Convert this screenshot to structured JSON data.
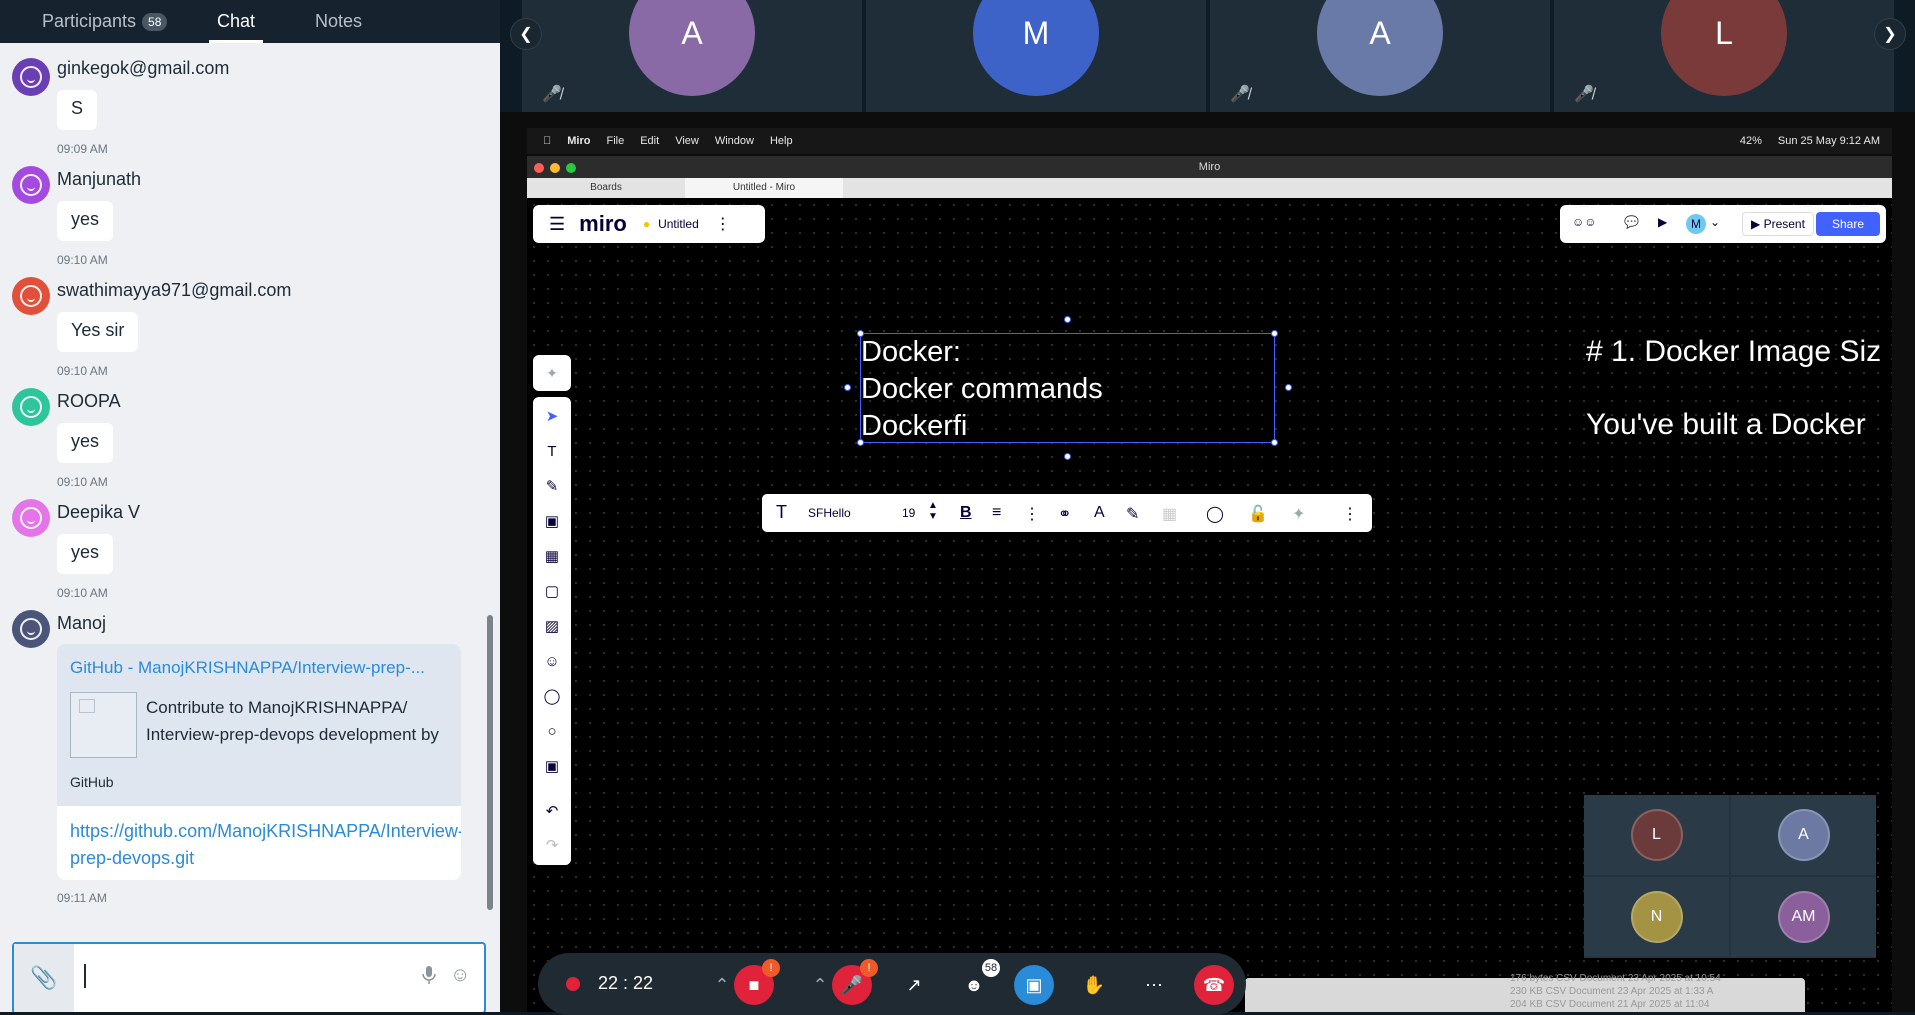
{
  "chat_panel": {
    "tabs": [
      {
        "label": "Participants",
        "count": "58"
      },
      {
        "label": "Chat"
      },
      {
        "label": "Notes"
      }
    ],
    "messages": [
      {
        "sender": "ginkegok@gmail.com",
        "text": "S",
        "time": "09:09 AM",
        "color": "#6a3fb5"
      },
      {
        "sender": "Manjunath",
        "text": "yes",
        "time": "09:10 AM",
        "color": "#a34be0"
      },
      {
        "sender": "swathimayya971@gmail.com",
        "text": "Yes sir",
        "time": "09:10 AM",
        "color": "#e0503a"
      },
      {
        "sender": "ROOPA",
        "text": "yes",
        "time": "09:10 AM",
        "color": "#2fc59c"
      },
      {
        "sender": "Deepika V",
        "text": "yes",
        "time": "09:10 AM",
        "color": "#e574e8"
      },
      {
        "sender": "Manoj",
        "time": "09:11 AM",
        "color": "#4a5578"
      }
    ],
    "link_card": {
      "title": "GitHub - ManojKRISHNAPPA/Interview-prep-...",
      "description": "Contribute to ManojKRISHNAPPA/ Interview-prep-devops development by creating an account on GitHub.",
      "site": "GitHub",
      "url": "https://github.com/ManojKRISHNAPPA/Interview-prep-devops.git"
    },
    "input_value": ""
  },
  "video_strip": {
    "tiles": [
      {
        "initial": "A",
        "color": "#8a6aa6"
      },
      {
        "initial": "M",
        "color": "#3d63c9"
      },
      {
        "initial": "A",
        "color": "#6a7aa8"
      },
      {
        "initial": "L",
        "color": "#7a3a3a"
      }
    ]
  },
  "mac": {
    "menu": [
      "Miro",
      "File",
      "Edit",
      "View",
      "Window",
      "Help"
    ],
    "battery": "42%",
    "clock": "Sun 25 May  9:12 AM",
    "window_title": "Miro",
    "tabs": [
      "Boards",
      "Untitled - Miro"
    ]
  },
  "miro": {
    "logo": "miro",
    "board_name": "Untitled",
    "present_label": "Present",
    "share_label": "Share",
    "user_initial": "M",
    "text_lines": "Docker:\nDocker commands\nDockerfi",
    "font_name": "SFHello",
    "font_size": "19",
    "right_heading": "# 1. Docker Image Siz",
    "right_line": "You've built a Docker"
  },
  "mini_videos": [
    {
      "initial": "L",
      "color": "#6b3a3a"
    },
    {
      "initial": "A",
      "color": "#6c7aa3"
    },
    {
      "initial": "N",
      "color": "#a39343"
    },
    {
      "initial": "AM",
      "color": "#8a5f9c"
    }
  ],
  "finder_rows": [
    "176 bytes   CSV Document    23 Apr 2025 at 10:54",
    "230 KB      CSV Document    23 Apr 2025 at 1:33 A",
    "204 KB      CSV Document    21 Apr 2025 at 11:04"
  ],
  "controls": {
    "timer": "22 : 22",
    "participants_count": "58",
    "alert": "!"
  }
}
